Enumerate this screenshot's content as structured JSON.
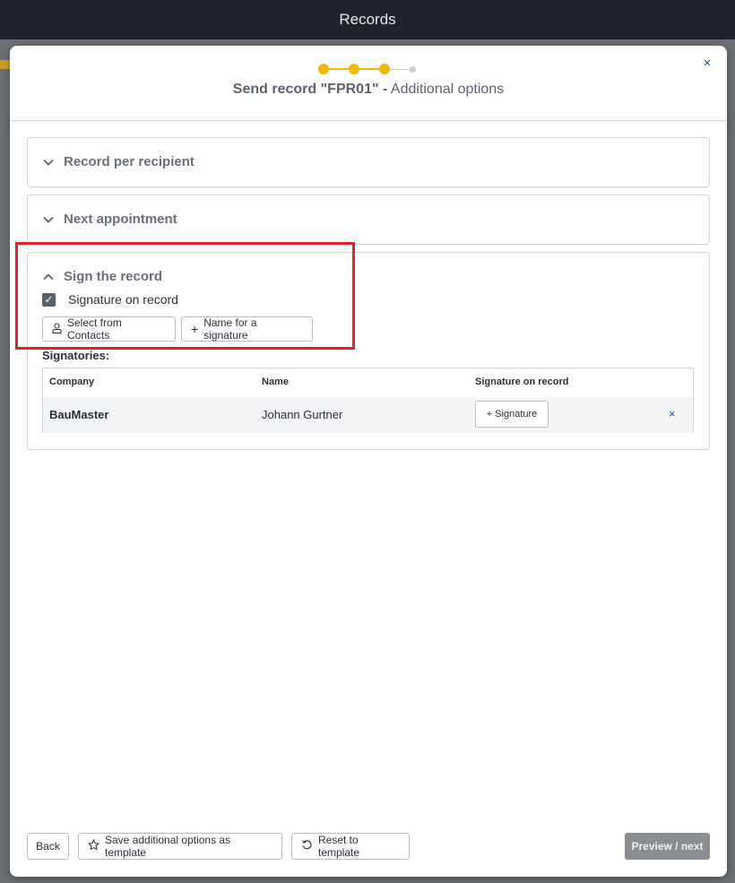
{
  "app": {
    "title": "Records"
  },
  "modal": {
    "title_bold": "Send record \"FPR01\" -",
    "title_rest": " Additional options",
    "close_icon": "×",
    "stepper": {
      "total_steps": 4,
      "current_step": 3
    }
  },
  "sections": {
    "record_per_recipient": {
      "label": "Record per recipient",
      "expanded": false
    },
    "next_appointment": {
      "label": "Next appointment",
      "expanded": false
    },
    "sign_the_record": {
      "label": "Sign the record",
      "expanded": true,
      "checkbox_label": "Signature on record",
      "checkbox_checked": true,
      "select_contacts_label": "Select from Contacts",
      "name_signature_label": "Name for a signature",
      "signatories_label": "Signatories:",
      "table": {
        "headers": {
          "company": "Company",
          "name": "Name",
          "signature": "Signature on record"
        },
        "rows": [
          {
            "company": "BauMaster",
            "name": "Johann Gurtner",
            "signature_button": "+ Signature",
            "remove_icon": "×"
          }
        ]
      }
    }
  },
  "footer": {
    "back": "Back",
    "save_template": "Save additional options as template",
    "reset_template": "Reset to template",
    "preview_next": "Preview / next"
  },
  "colors": {
    "accent": "#f2b705",
    "highlight": "#e0242b",
    "link": "#1f4a7a"
  }
}
